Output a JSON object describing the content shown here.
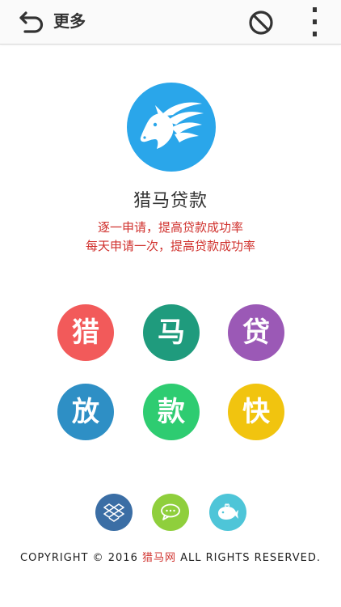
{
  "topbar": {
    "back_icon": "back-arrow-icon",
    "title": "更多",
    "block_icon": "block-icon",
    "more_icon": "more-vertical-icon"
  },
  "app": {
    "logo_icon": "horse-head-icon",
    "logo_color": "#2aa6ea",
    "name": "猎马贷款",
    "slogan_line1": "逐一申请，提高贷款成功率",
    "slogan_line2": "每天申请一次，提高贷款成功率",
    "slogan_color": "#d0312d"
  },
  "characters": [
    {
      "char": "猎",
      "color": "#f25a5a"
    },
    {
      "char": "马",
      "color": "#1f9b7d"
    },
    {
      "char": "贷",
      "color": "#9b59b6"
    },
    {
      "char": "放",
      "color": "#2e8fc5"
    },
    {
      "char": "款",
      "color": "#2ecc71"
    },
    {
      "char": "快",
      "color": "#f1c40f"
    }
  ],
  "social": [
    {
      "icon": "dropbox-icon",
      "color": "#3b6ea5"
    },
    {
      "icon": "chat-bubble-icon",
      "color": "#8fcf3c"
    },
    {
      "icon": "whale-icon",
      "color": "#4ec5d8"
    }
  ],
  "footer": {
    "prefix": "COPYRIGHT © 2016 ",
    "brand": "猎马网",
    "suffix": " ALL RIGHTS RESERVED."
  }
}
